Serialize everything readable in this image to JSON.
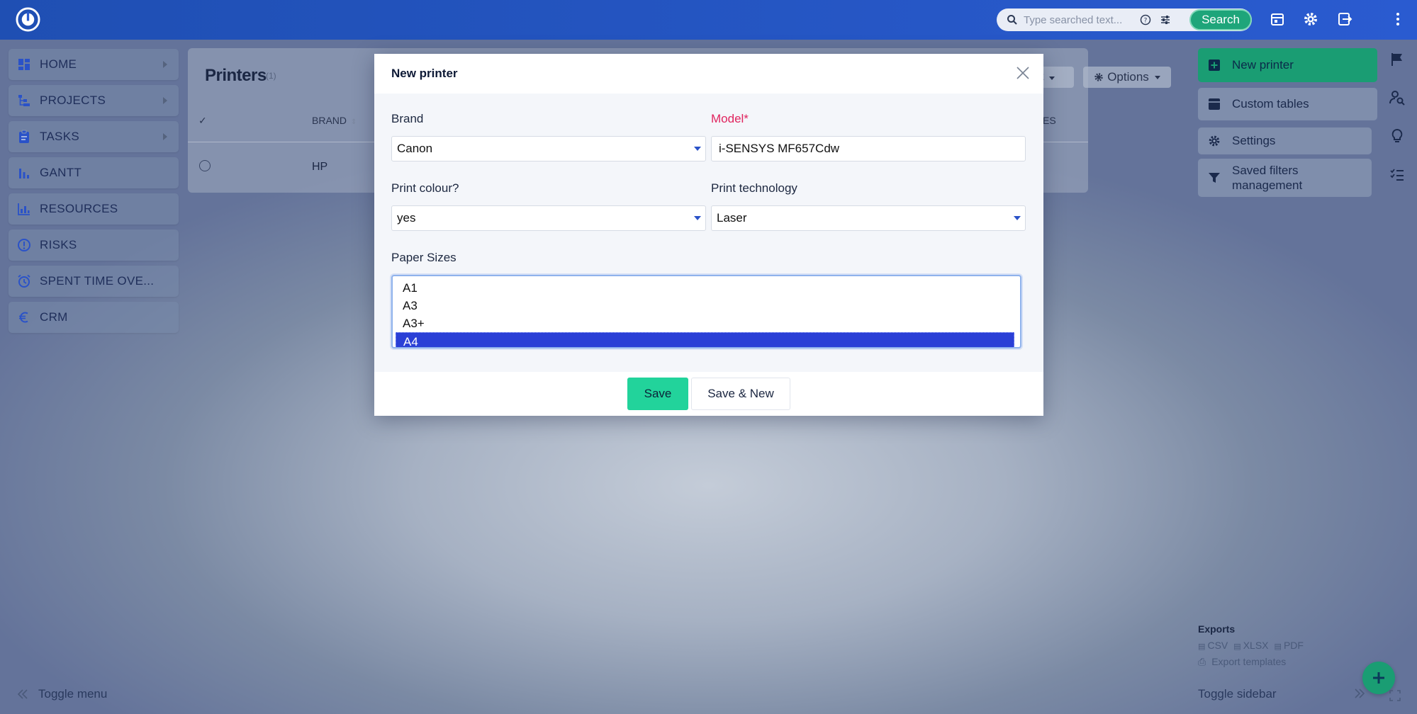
{
  "topbar": {
    "search_placeholder": "Type searched text...",
    "search_button": "Search",
    "icons": [
      "app-logo",
      "search-icon",
      "help-icon",
      "tune-icon",
      "calendar-icon",
      "gear-icon",
      "logout-icon",
      "more-vertical-icon"
    ]
  },
  "sidebar": {
    "items": [
      {
        "label": "HOME",
        "icon": "dashboard-icon",
        "has_arrow": true
      },
      {
        "label": "PROJECTS",
        "icon": "projects-icon",
        "has_arrow": true
      },
      {
        "label": "TASKS",
        "icon": "clipboard-icon",
        "has_arrow": true
      },
      {
        "label": "GANTT",
        "icon": "gantt-icon",
        "has_arrow": false
      },
      {
        "label": "RESOURCES",
        "icon": "bar-chart-icon",
        "has_arrow": false
      },
      {
        "label": "RISKS",
        "icon": "alert-icon",
        "has_arrow": false
      },
      {
        "label": "SPENT TIME OVE...",
        "icon": "alarm-icon",
        "has_arrow": false
      },
      {
        "label": "CRM",
        "icon": "euro-icon",
        "has_arrow": false
      }
    ],
    "toggle_label": "Toggle menu"
  },
  "page": {
    "title": "Printers",
    "count": "(1)",
    "columns": {
      "check": "✓",
      "brand": "BRAND",
      "partial": "ES"
    },
    "rows": [
      {
        "brand": "HP"
      }
    ],
    "filter_button_partial": "t",
    "options_button": "Options"
  },
  "right_sidebar": {
    "new_button": "New printer",
    "custom_tables": "Custom tables",
    "settings": "Settings",
    "saved_filters": "Saved filters management",
    "exports_title": "Exports",
    "export_formats": [
      "CSV",
      "XLSX",
      "PDF"
    ],
    "export_templates": "Export templates",
    "toggle_label": "Toggle sidebar"
  },
  "modal": {
    "title": "New printer",
    "brand_label": "Brand",
    "brand_value": "Canon",
    "model_label": "Model*",
    "model_value": "i-SENSYS MF657Cdw",
    "colour_label": "Print colour?",
    "colour_value": "yes",
    "technology_label": "Print technology",
    "technology_value": "Laser",
    "paper_sizes_label": "Paper Sizes",
    "paper_sizes": [
      {
        "label": "A1",
        "selected": false
      },
      {
        "label": "A3",
        "selected": false
      },
      {
        "label": "A3+",
        "selected": false
      },
      {
        "label": "A4",
        "selected": true
      }
    ],
    "save": "Save",
    "save_new": "Save & New"
  },
  "colors": {
    "topbar": "#2a5bd0",
    "accent_green": "#22d39b",
    "required": "#e0245e",
    "selected_option": "#2a3fd6"
  }
}
